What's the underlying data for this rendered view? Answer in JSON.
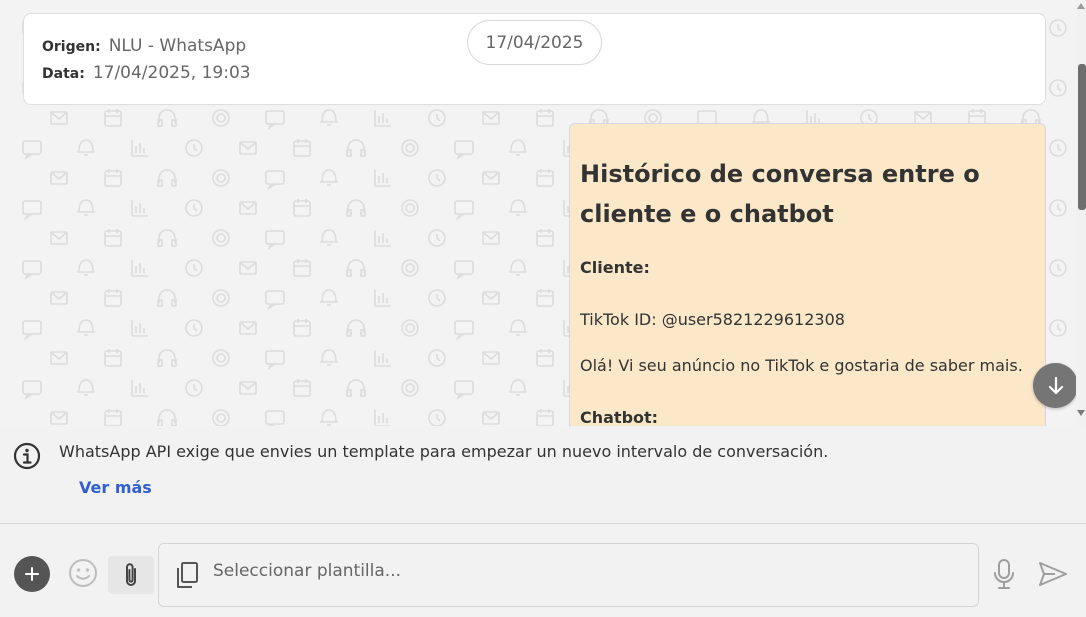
{
  "info_card": {
    "origin_label": "Origen:",
    "origin_value": "NLU - WhatsApp",
    "date_label": "Data:",
    "date_value": "17/04/2025, 19:03"
  },
  "date_pill": "17/04/2025",
  "message": {
    "title": "Histórico de conversa entre o cliente e o chatbot",
    "client_label": "Cliente:",
    "tiktok_id": "TikTok ID: @user5821229612308",
    "client_text": "Olá! Vi seu anúncio no TikTok e gostaria de saber mais.",
    "chatbot_label": "Chatbot:"
  },
  "notice": {
    "text": "WhatsApp API exige que envies un template para empezar un nuevo intervalo de conversación.",
    "see_more": "Ver más"
  },
  "composer": {
    "placeholder": "Seleccionar plantilla..."
  },
  "icons": {
    "info": "info-icon",
    "add": "plus-icon",
    "emoji": "smiley-icon",
    "attach": "paperclip-icon",
    "template": "copy-icon",
    "mic": "microphone-icon",
    "send": "send-icon",
    "scroll": "arrow-down-icon"
  },
  "colors": {
    "bubble": "#fbe8c9",
    "link": "#2f5fd1",
    "background": "#f2f2f2",
    "button_dark": "#555555"
  }
}
